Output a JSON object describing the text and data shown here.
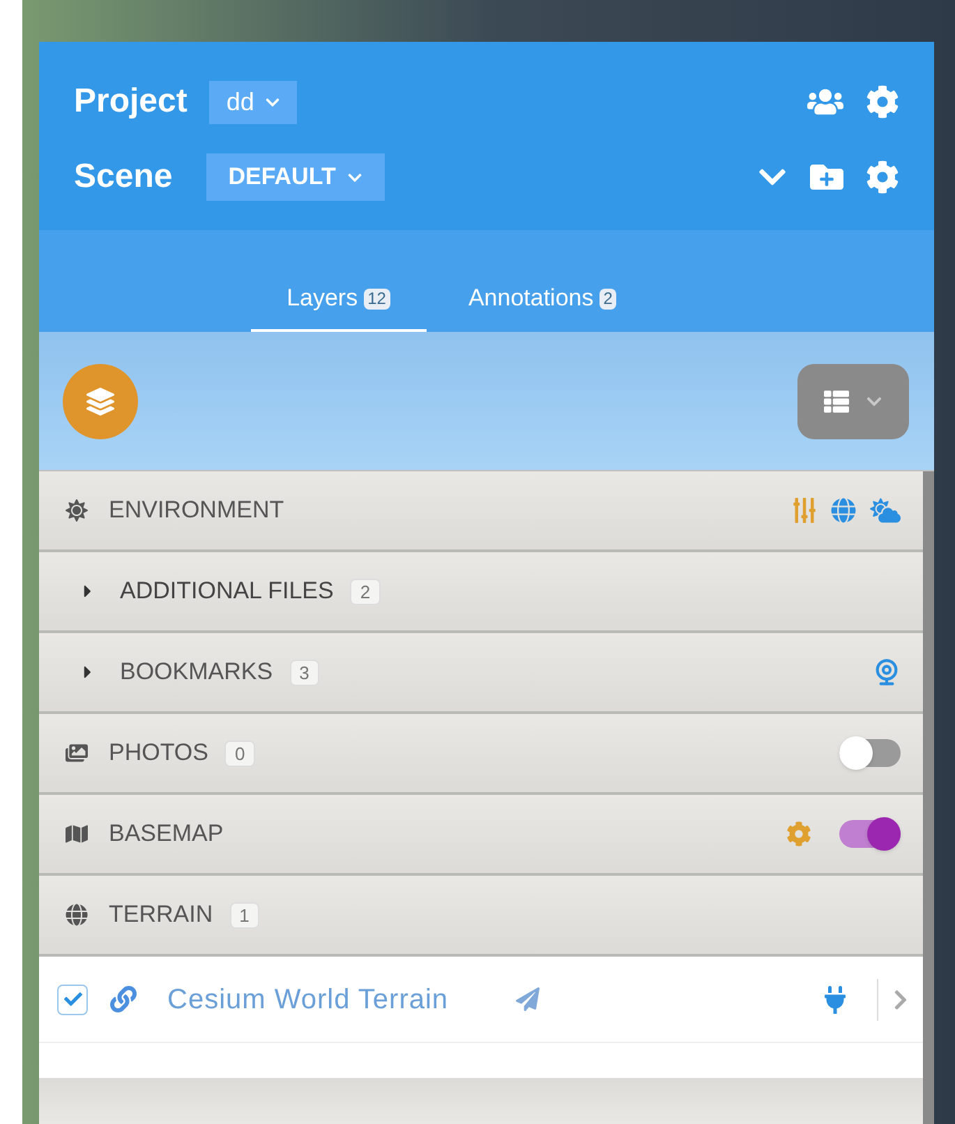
{
  "header": {
    "project_label": "Project",
    "project_value": "dd",
    "scene_label": "Scene",
    "scene_value": "DEFAULT"
  },
  "tabs": [
    {
      "label": "Layers",
      "count": "12",
      "selected": true
    },
    {
      "label": "Annotations",
      "count": "2",
      "selected": false
    }
  ],
  "sections": [
    {
      "kind": "environment",
      "label": "ENVIRONMENT"
    },
    {
      "kind": "files",
      "label": "ADDITIONAL FILES",
      "count": "2",
      "expanded": false
    },
    {
      "kind": "bookmarks",
      "label": "BOOKMARKS",
      "count": "3",
      "expanded": false
    },
    {
      "kind": "photos",
      "label": "PHOTOS",
      "count": "0",
      "on": false
    },
    {
      "kind": "basemap",
      "label": "BASEMAP",
      "on": true
    },
    {
      "kind": "terrain",
      "label": "TERRAIN",
      "count": "1"
    }
  ],
  "terrain_item": {
    "name": "Cesium World Terrain",
    "checked": true
  }
}
